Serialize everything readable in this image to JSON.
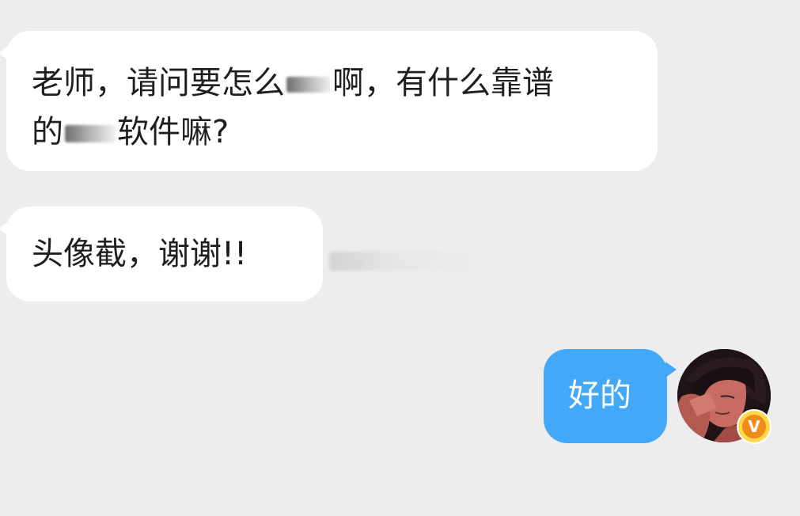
{
  "messages": [
    {
      "direction": "incoming",
      "lines": [
        [
          "老师，请问要怎么",
          "啊，有什么靠谱"
        ],
        [
          "的",
          "软件嘛?"
        ]
      ]
    },
    {
      "direction": "incoming",
      "text": "头像截，谢谢!!"
    },
    {
      "direction": "outgoing",
      "text": "好的"
    }
  ],
  "avatar": {
    "icon": "user-avatar-icon",
    "badge": "V"
  },
  "colors": {
    "background": "#ededed",
    "incoming_bubble": "#ffffff",
    "outgoing_bubble": "#44a8f8",
    "badge": "#f08a1a"
  }
}
